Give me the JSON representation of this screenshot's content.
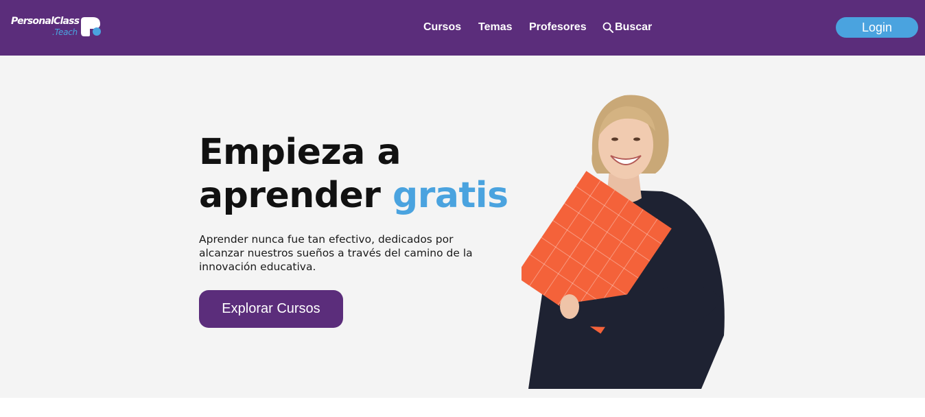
{
  "header": {
    "logo": {
      "main": "PersonalClass",
      "sub": ".Teach"
    },
    "nav": [
      {
        "label": "Cursos"
      },
      {
        "label": "Temas"
      },
      {
        "label": "Profesores"
      },
      {
        "label": "Buscar",
        "icon": "search-icon"
      }
    ],
    "login_label": "Login"
  },
  "hero": {
    "title_line1": "Empieza a",
    "title_line2_plain": "aprender ",
    "title_line2_highlight": "gratis",
    "description": "Aprender nunca fue tan efectivo, dedicados por alcanzar nuestros sueños a través del camino de la innovación educativa.",
    "cta_label": "Explorar Cursos"
  },
  "colors": {
    "brand_purple": "#5b2d7b",
    "accent_blue": "#4aa3df",
    "hero_background": "#f4f4f4",
    "book_orange": "#f4623a"
  }
}
